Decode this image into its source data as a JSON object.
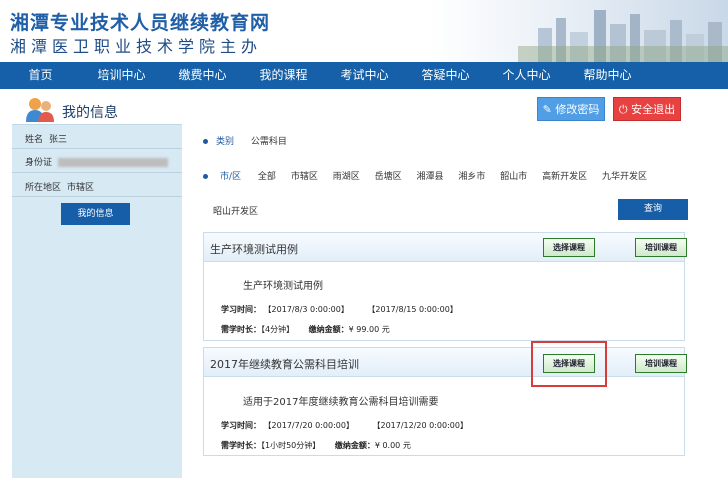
{
  "header": {
    "title": "湘潭专业技术人员继续教育网",
    "subtitle": "湘潭医卫职业技术学院主办"
  },
  "nav": [
    "首页",
    "培训中心",
    "缴费中心",
    "我的课程",
    "考试中心",
    "答疑中心",
    "个人中心",
    "帮助中心"
  ],
  "page": {
    "title": "我的信息",
    "change_password": "修改密码",
    "logout": "安全退出"
  },
  "profile": {
    "name_label": "姓名",
    "name_value": "张三",
    "id_label": "身份证",
    "region_label": "所在地区",
    "region_value": "市辖区",
    "myinfo_button": "我的信息"
  },
  "filters": {
    "category_label": "类别",
    "category_value": "公需科目",
    "city_label": "市/区",
    "cities": [
      "全部",
      "市辖区",
      "雨湖区",
      "岳塘区",
      "湘潭县",
      "湘乡市",
      "韶山市",
      "高新开发区",
      "九华开发区"
    ],
    "cities_row2": "昭山开发区",
    "query_button": "查询"
  },
  "courses": [
    {
      "title": "生产环境测试用例",
      "select_button": "选择课程",
      "train_button": "培训课程",
      "description": "生产环境测试用例",
      "study_time_label": "学习时间：",
      "study_start": "【2017/8/3 0:00:00】",
      "study_end": "【2017/8/15 0:00:00】",
      "duration_label": "需学时长：",
      "duration": "【4分钟】",
      "fee_label": "缴纳金额：",
      "fee": "¥ 99.00 元"
    },
    {
      "title": "2017年继续教育公需科目培训",
      "select_button": "选择课程",
      "train_button": "培训课程",
      "description": "适用于2017年度继续教育公需科目培训需要",
      "study_time_label": "学习时间：",
      "study_start": "【2017/7/20 0:00:00】",
      "study_end": "【2017/12/20 0:00:00】",
      "duration_label": "需学时长：",
      "duration": "【1小时50分钟】",
      "fee_label": "缴纳金额：",
      "fee": "¥ 0.00 元"
    }
  ],
  "icons": {
    "people": "people-icon",
    "edit": "edit-icon",
    "power": "power-icon"
  },
  "colors": {
    "nav_bg": "#1560a8",
    "panel_bg": "#d7e9f3",
    "highlight": "#d93a3a"
  }
}
